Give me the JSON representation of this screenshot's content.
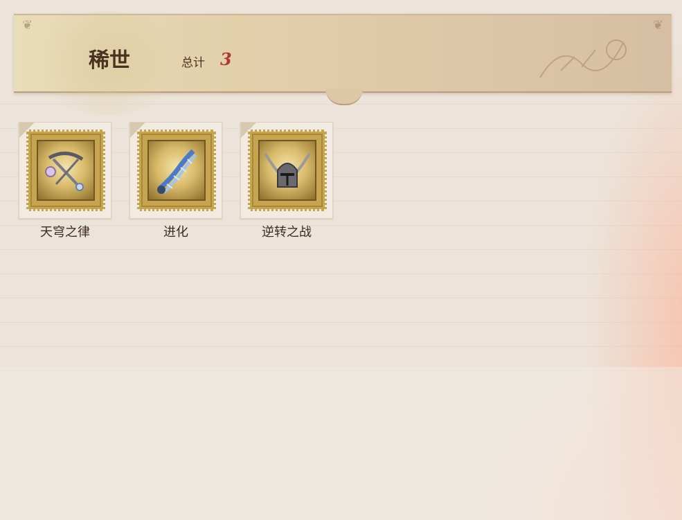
{
  "header": {
    "category": "稀世",
    "total_label": "总计",
    "total_count": "3"
  },
  "items": [
    {
      "name": "天穹之律",
      "icon": "chained-bow-icon"
    },
    {
      "name": "进化",
      "icon": "dna-helix-icon"
    },
    {
      "name": "逆转之战",
      "icon": "winged-helmet-icon"
    }
  ],
  "colors": {
    "background": "#ece4da",
    "banner": "#e2cfaa",
    "title_text": "#4a3220",
    "count_accent": "#b2382e",
    "stamp_gold": "#c7a44f"
  }
}
